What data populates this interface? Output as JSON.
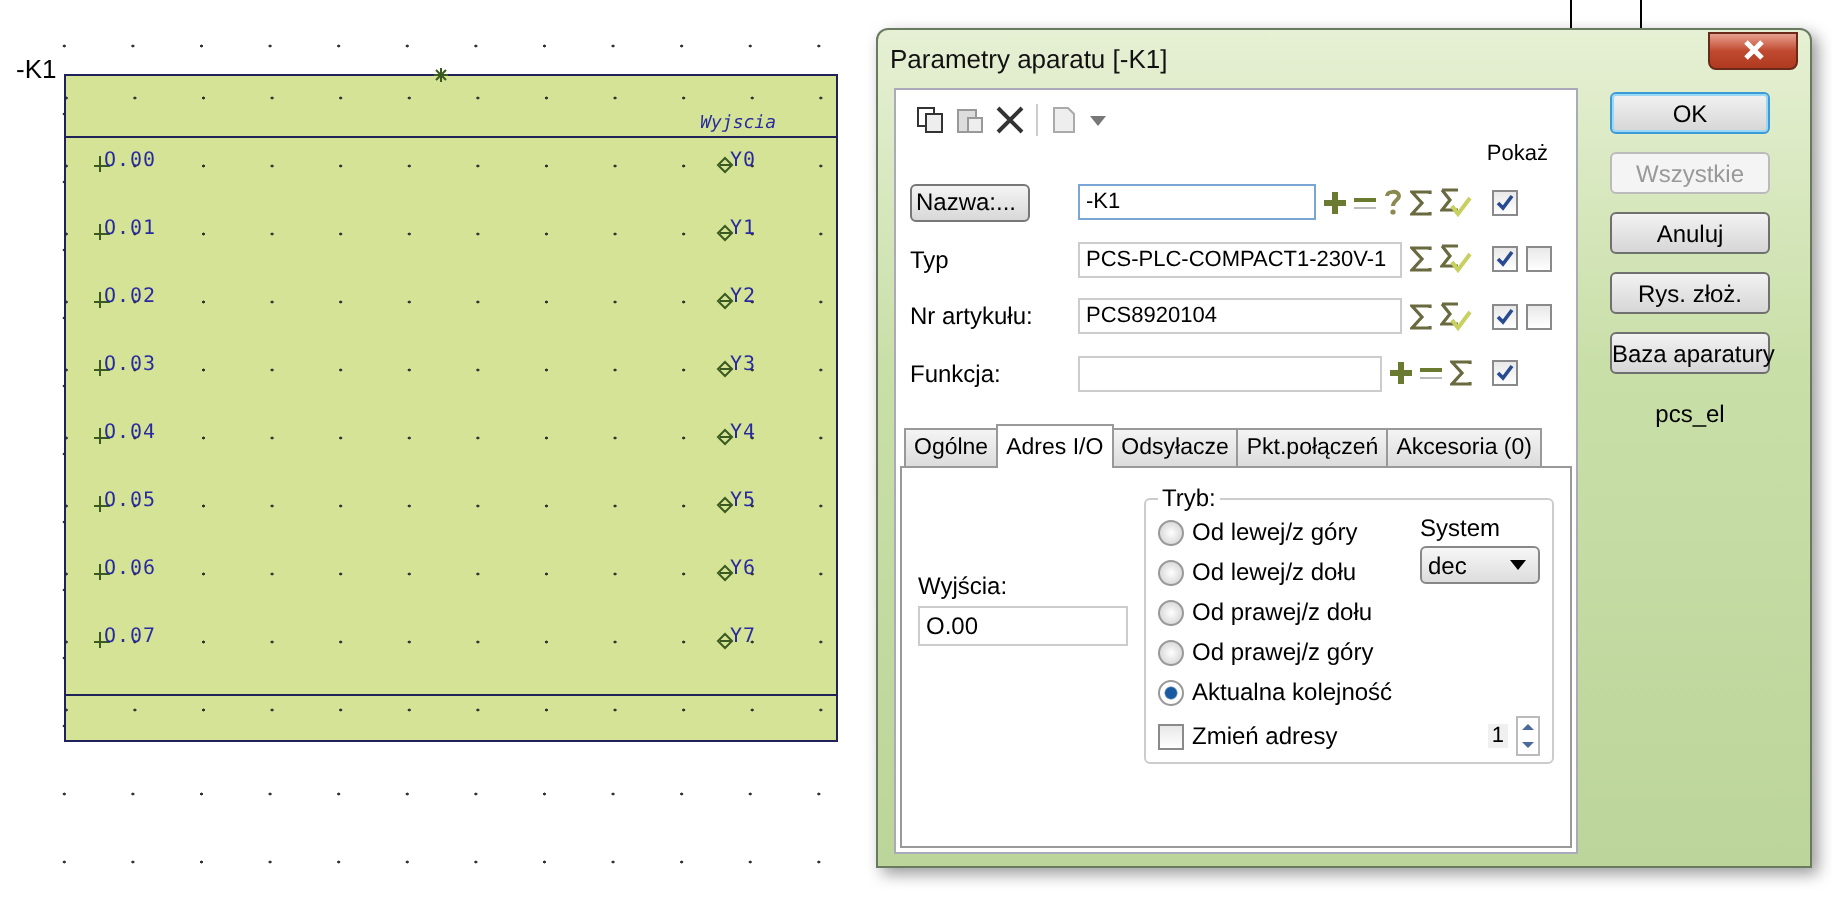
{
  "canvas": {
    "device_label": "-K1",
    "block": {
      "header": "Wyjscia",
      "pins": [
        {
          "left": "O.00",
          "right": "Y0"
        },
        {
          "left": "O.01",
          "right": "Y1"
        },
        {
          "left": "O.02",
          "right": "Y2"
        },
        {
          "left": "O.03",
          "right": "Y3"
        },
        {
          "left": "O.04",
          "right": "Y4"
        },
        {
          "left": "O.05",
          "right": "Y5"
        },
        {
          "left": "O.06",
          "right": "Y6"
        },
        {
          "left": "O.07",
          "right": "Y7"
        }
      ]
    }
  },
  "dialog": {
    "title": "Parametry aparatu [-K1]",
    "show_header": "Pokaż",
    "fields": [
      {
        "kind": "button",
        "label": "Nazwa:...",
        "value": "-K1",
        "focused": true,
        "add_remove": true,
        "help": true,
        "sum": true,
        "sum_check": true,
        "checks": [
          true
        ]
      },
      {
        "kind": "label",
        "label": "Typ",
        "value": "PCS-PLC-COMPACT1-230V-1",
        "focused": false,
        "add_remove": false,
        "help": false,
        "sum": true,
        "sum_check": true,
        "checks": [
          true,
          false
        ]
      },
      {
        "kind": "label",
        "label": "Nr artykułu:",
        "value": "PCS8920104",
        "focused": false,
        "add_remove": false,
        "help": false,
        "sum": true,
        "sum_check": true,
        "checks": [
          true,
          false
        ]
      },
      {
        "kind": "label",
        "label": "Funkcja:",
        "focused": false,
        "add_remove": true,
        "help": false,
        "sum": true,
        "sum_check": false,
        "checks": [
          true
        ]
      }
    ],
    "tabs": [
      {
        "label": "Ogólne",
        "selected": false
      },
      {
        "label": "Adres I/O",
        "selected": true
      },
      {
        "label": "Odsyłacze",
        "selected": false
      },
      {
        "label": "Pkt.połączeń",
        "selected": false
      },
      {
        "label": "Akcesoria (0)",
        "selected": false
      }
    ],
    "outputs": {
      "label": "Wyjścia:",
      "value": "O.00"
    },
    "mode": {
      "legend": "Tryb:",
      "options": [
        {
          "label": "Od lewej/z góry",
          "selected": false
        },
        {
          "label": "Od lewej/z dołu",
          "selected": false
        },
        {
          "label": "Od prawej/z dołu",
          "selected": false
        },
        {
          "label": "Od prawej/z góry",
          "selected": false
        },
        {
          "label": "Aktualna kolejność",
          "selected": true
        }
      ],
      "system_label": "System",
      "system_value": "dec",
      "change_label": "Zmień adresy",
      "change_checked": false,
      "step": "1"
    },
    "buttons": [
      {
        "label": "OK",
        "default": true,
        "disabled": false
      },
      {
        "label": "Wszystkie",
        "default": false,
        "disabled": true
      },
      {
        "label": "Anuluj",
        "default": false,
        "disabled": false
      },
      {
        "label": "Rys. złoż.",
        "default": false,
        "disabled": false
      },
      {
        "label": "Baza aparatury",
        "default": false,
        "disabled": false
      }
    ],
    "library": "pcs_el"
  }
}
